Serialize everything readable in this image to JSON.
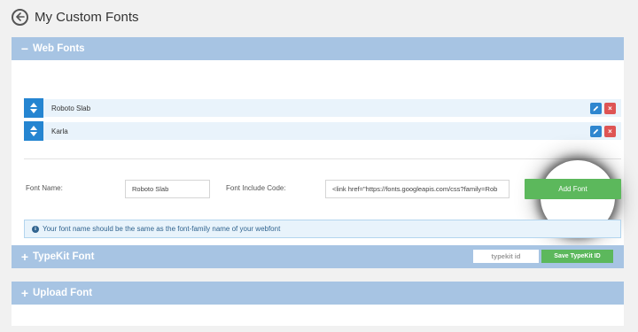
{
  "header": {
    "title": "My Custom Fonts",
    "back_icon": "back-arrow-circle-icon"
  },
  "web_fonts": {
    "heading": "Web Fonts",
    "toggle_symbol": "−",
    "fonts": [
      {
        "name": "Roboto Slab"
      },
      {
        "name": "Karla"
      }
    ],
    "form": {
      "font_name_label": "Font Name:",
      "font_name_value": "Roboto Slab",
      "include_code_label": "Font Include Code:",
      "include_code_value": "<link href=\"https://fonts.googleapis.com/css?family=Rob",
      "add_button": "Add Font"
    },
    "info": "Your font name should be the same as the font-family name of your webfont"
  },
  "typekit": {
    "heading": "TypeKit Font",
    "toggle_symbol": "+",
    "input_placeholder": "typekit id",
    "save_button": "Save TypeKit ID"
  },
  "upload": {
    "heading": "Upload Font",
    "toggle_symbol": "+"
  },
  "colors": {
    "panel_header": "#a7c4e3",
    "primary_blue": "#2585d1",
    "success_green": "#5cb85c",
    "danger_red": "#de5454"
  }
}
